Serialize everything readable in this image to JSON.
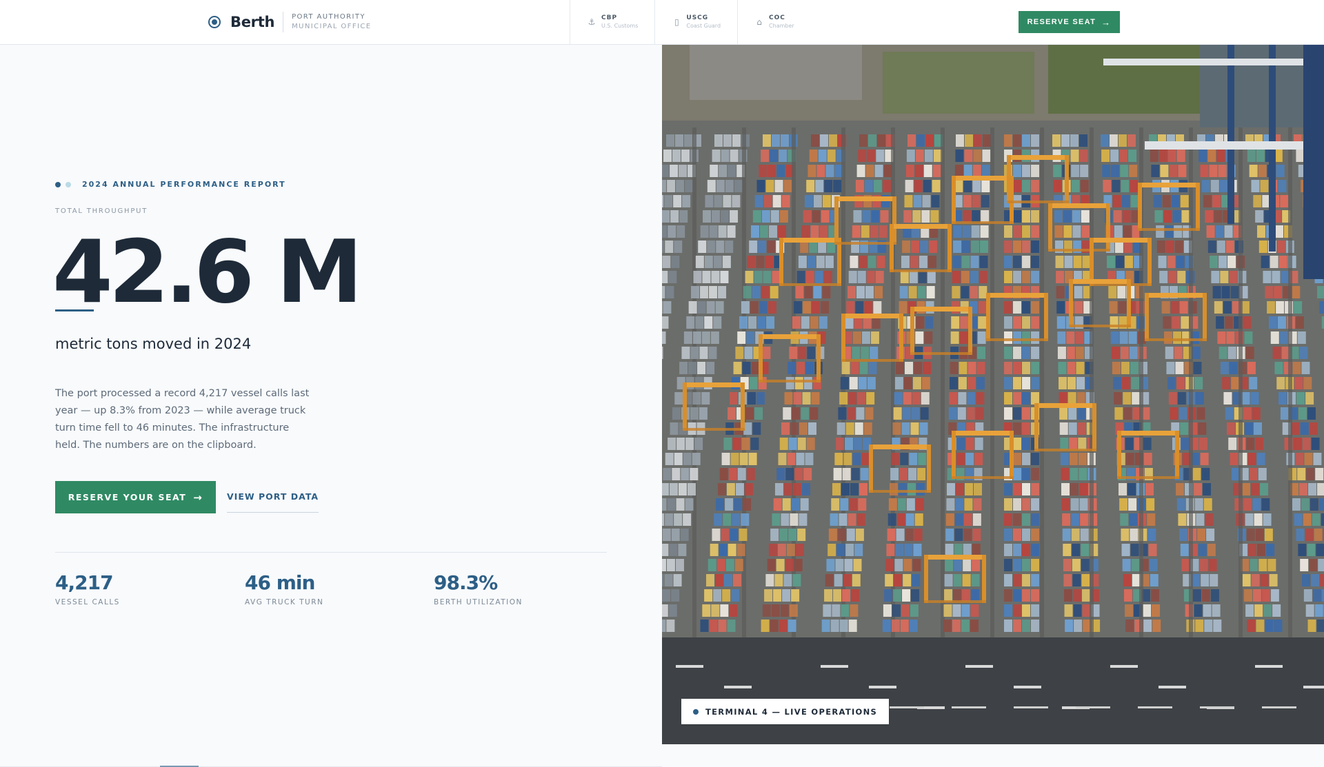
{
  "header": {
    "brand_name": "Berth",
    "brand_sub_1": "PORT AUTHORITY",
    "brand_sub_2": "MUNICIPAL OFFICE",
    "agencies": [
      {
        "code": "CBP",
        "name": "U.S. Customs",
        "icon": "anchor-icon"
      },
      {
        "code": "USCG",
        "name": "Coast Guard",
        "icon": "shield-icon"
      },
      {
        "code": "COC",
        "name": "Chamber",
        "icon": "building-icon"
      }
    ],
    "cta_label": "RESERVE SEAT"
  },
  "hero": {
    "eyebrow": "2024 ANNUAL PERFORMANCE REPORT",
    "kicker": "TOTAL THROUGHPUT",
    "big_number": "42.6 M",
    "subhead": "metric tons moved in 2024",
    "paragraph": "The port processed a record 4,217 vessel calls last year — up 8.3% from 2023 — while average truck turn time fell to 46 minutes. The infrastructure held. The numbers are on the clipboard.",
    "primary_cta": "RESERVE YOUR SEAT",
    "secondary_cta": "VIEW PORT DATA"
  },
  "stats": [
    {
      "value": "4,217",
      "label": "VESSEL CALLS"
    },
    {
      "value": "46 min",
      "label": "AVG TRUCK TURN"
    },
    {
      "value": "98.3%",
      "label": "BERTH UTILIZATION"
    }
  ],
  "photo": {
    "badge": "TERMINAL 4 — LIVE OPERATIONS"
  },
  "colors": {
    "accent": "#2d5f86",
    "cta_green": "#2f8a63",
    "text_dark": "#1e2a38"
  }
}
